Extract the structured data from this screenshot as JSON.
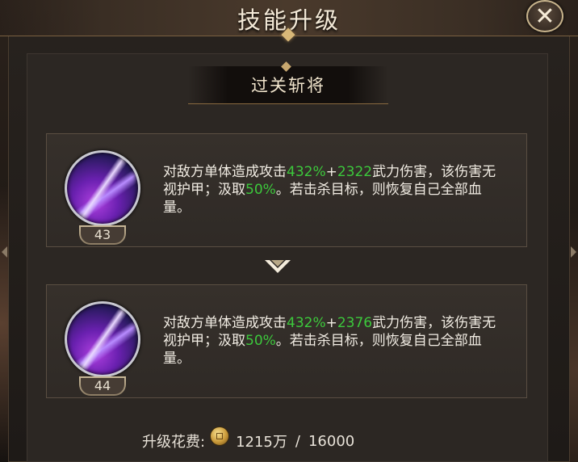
{
  "window": {
    "title": "技能升级",
    "close_label": "✕"
  },
  "skill": {
    "name": "过关斩将",
    "current": {
      "level": "43",
      "desc_part1": "对敌方单体造成攻击",
      "attack_pct": "432%",
      "desc_plus": "+",
      "flat_damage": "2322",
      "desc_part2": "武力伤害，该伤害无视护甲；汲取",
      "drain_pct": "50%",
      "desc_part3": "。若击杀目标，则恢复自己全部血量。"
    },
    "next": {
      "level": "44",
      "desc_part1": "对敌方单体造成攻击",
      "attack_pct": "432%",
      "desc_plus": "+",
      "flat_damage": "2376",
      "desc_part2": "武力伤害，该伤害无视护甲；汲取",
      "drain_pct": "50%",
      "desc_part3": "。若击杀目标，则恢复自己全部血量。"
    }
  },
  "cost": {
    "label": "升级花费:",
    "icon": "gold-coin-icon",
    "owned": "1215万",
    "separator": "/",
    "required": "16000"
  },
  "colors": {
    "highlight": "#3cc83c",
    "text": "#f2ede4"
  }
}
